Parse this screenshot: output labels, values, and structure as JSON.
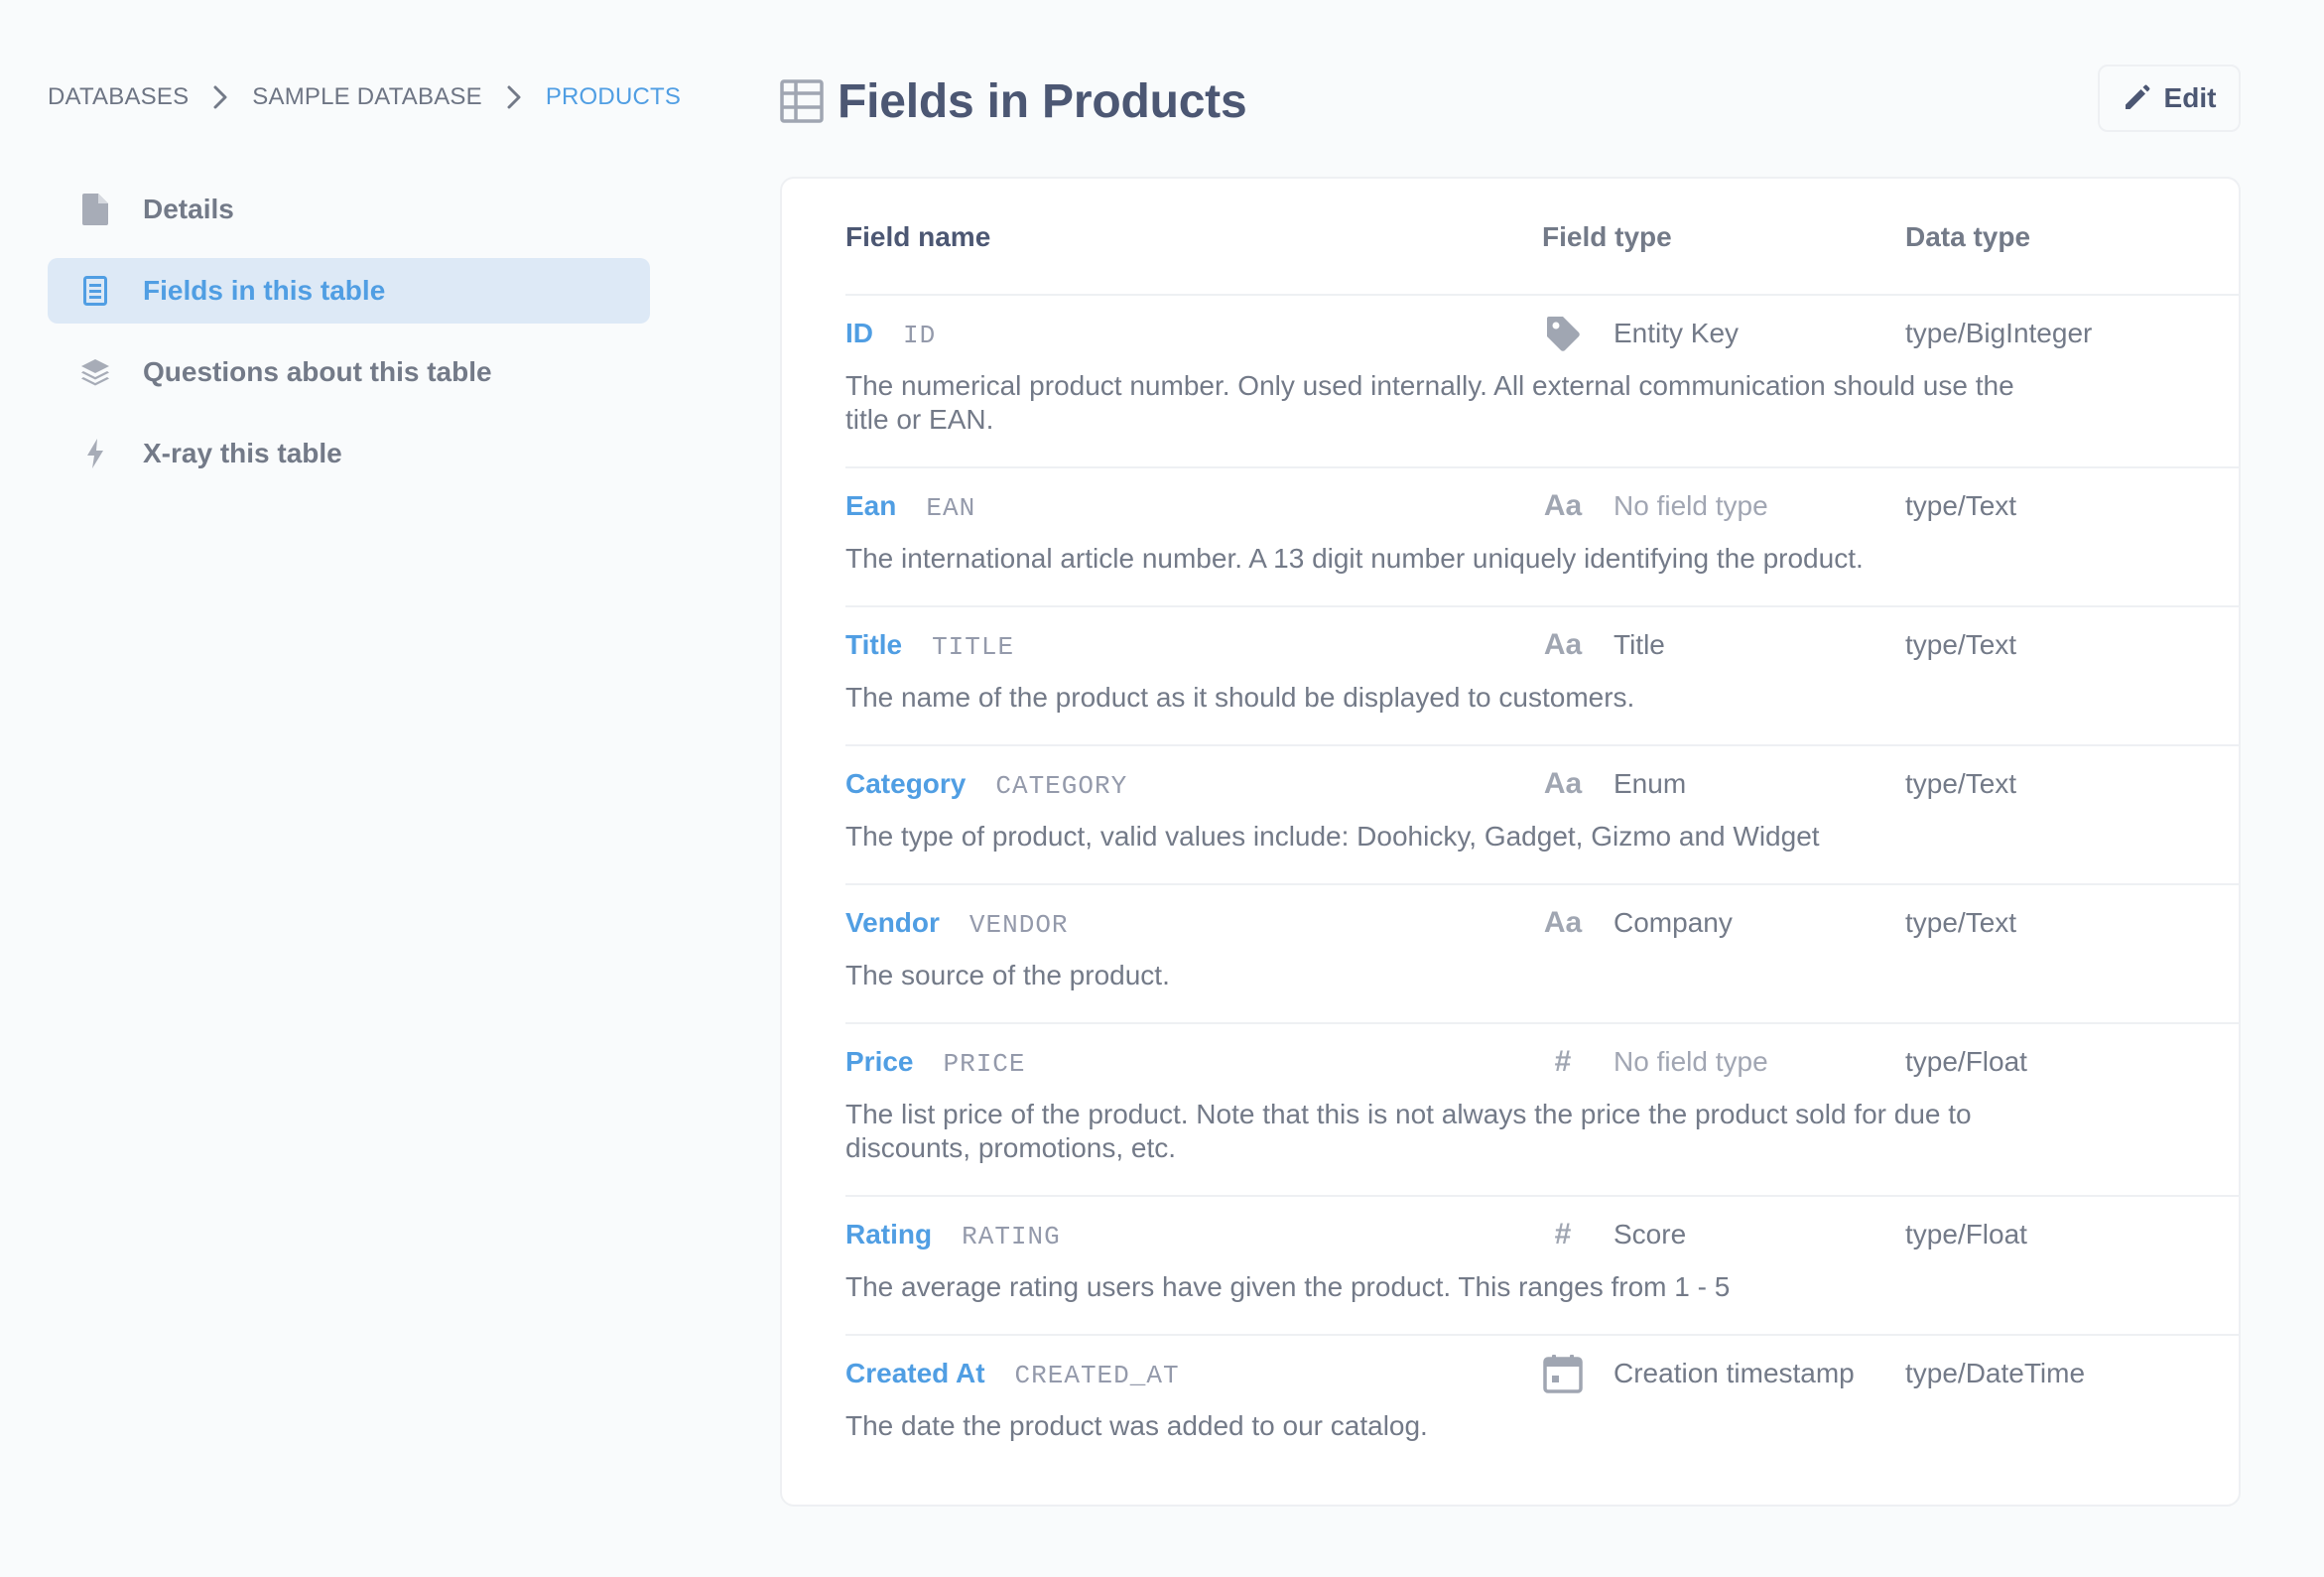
{
  "breadcrumb": {
    "items": [
      "DATABASES",
      "SAMPLE DATABASE",
      "PRODUCTS"
    ]
  },
  "nav": {
    "items": [
      {
        "label": "Details",
        "icon": "document-icon"
      },
      {
        "label": "Fields in this table",
        "icon": "list-icon",
        "active": true
      },
      {
        "label": "Questions about this table",
        "icon": "layers-icon"
      },
      {
        "label": "X-ray this table",
        "icon": "bolt-icon"
      }
    ]
  },
  "header": {
    "title": "Fields in Products",
    "icon": "table-icon",
    "edit_label": "Edit"
  },
  "table": {
    "columns": [
      "Field name",
      "Field type",
      "Data type"
    ],
    "rows": [
      {
        "name": "ID",
        "db_name": "ID",
        "field_type": "Entity Key",
        "field_type_icon": "tag-icon",
        "data_type": "type/BigInteger",
        "description": "The numerical product number. Only used internally. All external communication should use the title or EAN."
      },
      {
        "name": "Ean",
        "db_name": "EAN",
        "field_type": "No field type",
        "field_type_icon": "text-icon",
        "data_type": "type/Text",
        "description": "The international article number. A 13 digit number uniquely identifying the product."
      },
      {
        "name": "Title",
        "db_name": "TITLE",
        "field_type": "Title",
        "field_type_icon": "text-icon",
        "data_type": "type/Text",
        "description": "The name of the product as it should be displayed to customers."
      },
      {
        "name": "Category",
        "db_name": "CATEGORY",
        "field_type": "Enum",
        "field_type_icon": "text-icon",
        "data_type": "type/Text",
        "description": "The type of product, valid values include: Doohicky, Gadget, Gizmo and Widget"
      },
      {
        "name": "Vendor",
        "db_name": "VENDOR",
        "field_type": "Company",
        "field_type_icon": "text-icon",
        "data_type": "type/Text",
        "description": "The source of the product."
      },
      {
        "name": "Price",
        "db_name": "PRICE",
        "field_type": "No field type",
        "field_type_icon": "number-icon",
        "data_type": "type/Float",
        "description": "The list price of the product. Note that this is not always the price the product sold for due to discounts, promotions, etc."
      },
      {
        "name": "Rating",
        "db_name": "RATING",
        "field_type": "Score",
        "field_type_icon": "number-icon",
        "data_type": "type/Float",
        "description": "The average rating users have given the product. This ranges from 1 - 5"
      },
      {
        "name": "Created At",
        "db_name": "CREATED_AT",
        "field_type": "Creation timestamp",
        "field_type_icon": "calendar-icon",
        "data_type": "type/DateTime",
        "description": "The date the product was added to our catalog."
      }
    ]
  },
  "glyphs": {
    "text": "Aa",
    "number": "#"
  },
  "colors": {
    "brand": "#509ee3",
    "active_bg": "#dde9f6",
    "text_dark": "#4c5773",
    "text_medium": "#737a88",
    "text_light": "#949aab",
    "border": "#eef0f3"
  }
}
